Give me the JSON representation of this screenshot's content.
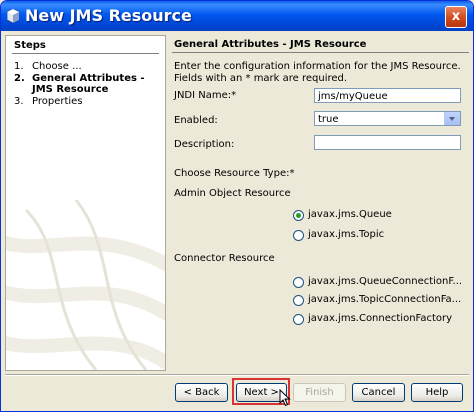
{
  "window": {
    "title": "New JMS Resource",
    "close_label": "x",
    "title_color": "#0058ee"
  },
  "steps": {
    "header": "Steps",
    "items": [
      {
        "num": "1.",
        "label": "Choose ..."
      },
      {
        "num": "2.",
        "label": "General Attributes - JMS Resource"
      },
      {
        "num": "3.",
        "label": "Properties"
      }
    ],
    "current_index": 1
  },
  "main": {
    "header": "General Attributes - JMS Resource",
    "description": "Enter the configuration information for the JMS Resource. Fields with an * mark are required.",
    "jndi_label": "JNDI Name:*",
    "jndi_value": "jms/myQueue",
    "enabled_label": "Enabled:",
    "enabled_value": "true",
    "description_label": "Description:",
    "description_value": "",
    "resource_type_label": "Choose Resource Type:*",
    "admin_label": "Admin Object Resource",
    "admin_options": [
      {
        "label": "javax.jms.Queue",
        "checked": true
      },
      {
        "label": "javax.jms.Topic",
        "checked": false
      }
    ],
    "connector_label": "Connector Resource",
    "connector_options": [
      {
        "label": "javax.jms.QueueConnectionF...",
        "checked": false
      },
      {
        "label": "javax.jms.TopicConnectionFa...",
        "checked": false
      },
      {
        "label": "javax.jms.ConnectionFactory",
        "checked": false
      }
    ]
  },
  "buttons": {
    "back": "< Back",
    "next": "Next >",
    "finish": "Finish",
    "cancel": "Cancel",
    "help": "Help"
  },
  "highlight_color": "#d83434"
}
